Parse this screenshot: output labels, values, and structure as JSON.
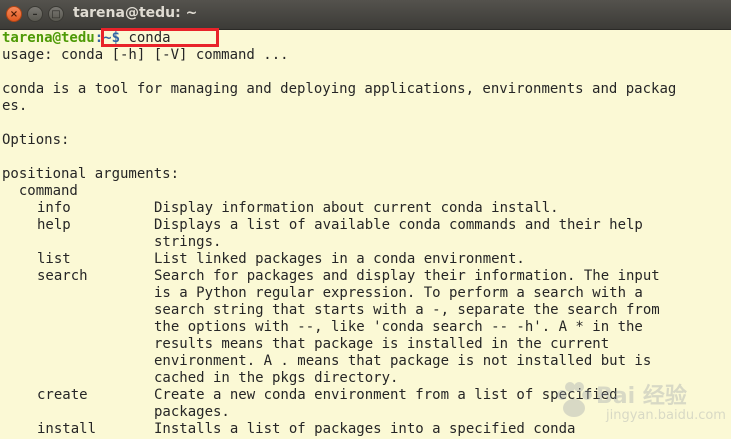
{
  "window": {
    "title": "tarena@tedu: ~",
    "close_glyph": "×",
    "minimize_glyph": "–",
    "maximize_glyph": "□"
  },
  "prompt": {
    "user_host": "tarena@tedu",
    "path_and_symbol": ":~$ ",
    "command": "conda"
  },
  "output": {
    "usage": "usage: conda [-h] [-V] command ...",
    "desc_line1": "conda is a tool for managing and deploying applications, environments and packag",
    "desc_line2": "es.",
    "options": "Options:",
    "positional": "positional arguments:",
    "command_header": "  command"
  },
  "commands": [
    {
      "name": "info",
      "desc": [
        "Display information about current conda install."
      ]
    },
    {
      "name": "help",
      "desc": [
        "Displays a list of available conda commands and their help",
        "strings."
      ]
    },
    {
      "name": "list",
      "desc": [
        "List linked packages in a conda environment."
      ]
    },
    {
      "name": "search",
      "desc": [
        "Search for packages and display their information. The input",
        "is a Python regular expression. To perform a search with a",
        "search string that starts with a -, separate the search from",
        "the options with --, like 'conda search -- -h'. A * in the",
        "results means that package is installed in the current",
        "environment. A . means that package is not installed but is",
        "cached in the pkgs directory."
      ]
    },
    {
      "name": "create",
      "desc": [
        "Create a new conda environment from a list of specified",
        "packages."
      ]
    },
    {
      "name": "install",
      "desc": [
        "Installs a list of packages into a specified conda"
      ]
    }
  ],
  "watermark": {
    "text": "Bai 经验",
    "sub": "jingyan.baidu.com"
  },
  "colors": {
    "terminal_bg": "#fbf9d5",
    "prompt_user": "#4e9a06",
    "highlight_box": "#e8232a"
  }
}
